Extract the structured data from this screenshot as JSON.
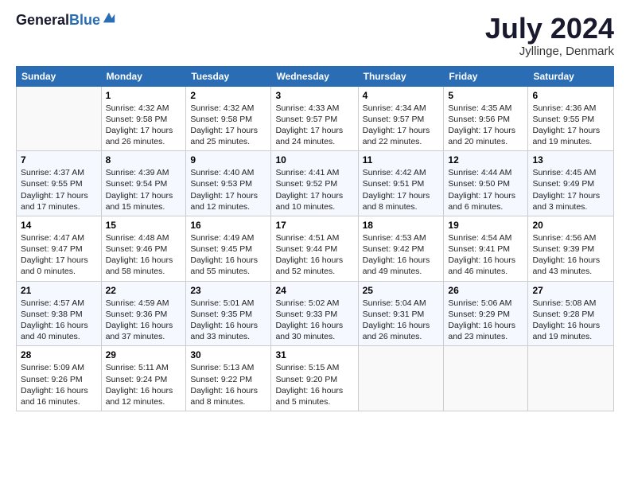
{
  "header": {
    "logo_general": "General",
    "logo_blue": "Blue",
    "month_title": "July 2024",
    "location": "Jyllinge, Denmark"
  },
  "calendar": {
    "days_header": [
      "Sunday",
      "Monday",
      "Tuesday",
      "Wednesday",
      "Thursday",
      "Friday",
      "Saturday"
    ],
    "weeks": [
      [
        {
          "day": "",
          "content": ""
        },
        {
          "day": "1",
          "content": "Sunrise: 4:32 AM\nSunset: 9:58 PM\nDaylight: 17 hours and 26 minutes."
        },
        {
          "day": "2",
          "content": "Sunrise: 4:32 AM\nSunset: 9:58 PM\nDaylight: 17 hours and 25 minutes."
        },
        {
          "day": "3",
          "content": "Sunrise: 4:33 AM\nSunset: 9:57 PM\nDaylight: 17 hours and 24 minutes."
        },
        {
          "day": "4",
          "content": "Sunrise: 4:34 AM\nSunset: 9:57 PM\nDaylight: 17 hours and 22 minutes."
        },
        {
          "day": "5",
          "content": "Sunrise: 4:35 AM\nSunset: 9:56 PM\nDaylight: 17 hours and 20 minutes."
        },
        {
          "day": "6",
          "content": "Sunrise: 4:36 AM\nSunset: 9:55 PM\nDaylight: 17 hours and 19 minutes."
        }
      ],
      [
        {
          "day": "7",
          "content": "Sunrise: 4:37 AM\nSunset: 9:55 PM\nDaylight: 17 hours and 17 minutes."
        },
        {
          "day": "8",
          "content": "Sunrise: 4:39 AM\nSunset: 9:54 PM\nDaylight: 17 hours and 15 minutes."
        },
        {
          "day": "9",
          "content": "Sunrise: 4:40 AM\nSunset: 9:53 PM\nDaylight: 17 hours and 12 minutes."
        },
        {
          "day": "10",
          "content": "Sunrise: 4:41 AM\nSunset: 9:52 PM\nDaylight: 17 hours and 10 minutes."
        },
        {
          "day": "11",
          "content": "Sunrise: 4:42 AM\nSunset: 9:51 PM\nDaylight: 17 hours and 8 minutes."
        },
        {
          "day": "12",
          "content": "Sunrise: 4:44 AM\nSunset: 9:50 PM\nDaylight: 17 hours and 6 minutes."
        },
        {
          "day": "13",
          "content": "Sunrise: 4:45 AM\nSunset: 9:49 PM\nDaylight: 17 hours and 3 minutes."
        }
      ],
      [
        {
          "day": "14",
          "content": "Sunrise: 4:47 AM\nSunset: 9:47 PM\nDaylight: 17 hours and 0 minutes."
        },
        {
          "day": "15",
          "content": "Sunrise: 4:48 AM\nSunset: 9:46 PM\nDaylight: 16 hours and 58 minutes."
        },
        {
          "day": "16",
          "content": "Sunrise: 4:49 AM\nSunset: 9:45 PM\nDaylight: 16 hours and 55 minutes."
        },
        {
          "day": "17",
          "content": "Sunrise: 4:51 AM\nSunset: 9:44 PM\nDaylight: 16 hours and 52 minutes."
        },
        {
          "day": "18",
          "content": "Sunrise: 4:53 AM\nSunset: 9:42 PM\nDaylight: 16 hours and 49 minutes."
        },
        {
          "day": "19",
          "content": "Sunrise: 4:54 AM\nSunset: 9:41 PM\nDaylight: 16 hours and 46 minutes."
        },
        {
          "day": "20",
          "content": "Sunrise: 4:56 AM\nSunset: 9:39 PM\nDaylight: 16 hours and 43 minutes."
        }
      ],
      [
        {
          "day": "21",
          "content": "Sunrise: 4:57 AM\nSunset: 9:38 PM\nDaylight: 16 hours and 40 minutes."
        },
        {
          "day": "22",
          "content": "Sunrise: 4:59 AM\nSunset: 9:36 PM\nDaylight: 16 hours and 37 minutes."
        },
        {
          "day": "23",
          "content": "Sunrise: 5:01 AM\nSunset: 9:35 PM\nDaylight: 16 hours and 33 minutes."
        },
        {
          "day": "24",
          "content": "Sunrise: 5:02 AM\nSunset: 9:33 PM\nDaylight: 16 hours and 30 minutes."
        },
        {
          "day": "25",
          "content": "Sunrise: 5:04 AM\nSunset: 9:31 PM\nDaylight: 16 hours and 26 minutes."
        },
        {
          "day": "26",
          "content": "Sunrise: 5:06 AM\nSunset: 9:29 PM\nDaylight: 16 hours and 23 minutes."
        },
        {
          "day": "27",
          "content": "Sunrise: 5:08 AM\nSunset: 9:28 PM\nDaylight: 16 hours and 19 minutes."
        }
      ],
      [
        {
          "day": "28",
          "content": "Sunrise: 5:09 AM\nSunset: 9:26 PM\nDaylight: 16 hours and 16 minutes."
        },
        {
          "day": "29",
          "content": "Sunrise: 5:11 AM\nSunset: 9:24 PM\nDaylight: 16 hours and 12 minutes."
        },
        {
          "day": "30",
          "content": "Sunrise: 5:13 AM\nSunset: 9:22 PM\nDaylight: 16 hours and 8 minutes."
        },
        {
          "day": "31",
          "content": "Sunrise: 5:15 AM\nSunset: 9:20 PM\nDaylight: 16 hours and 5 minutes."
        },
        {
          "day": "",
          "content": ""
        },
        {
          "day": "",
          "content": ""
        },
        {
          "day": "",
          "content": ""
        }
      ]
    ]
  }
}
